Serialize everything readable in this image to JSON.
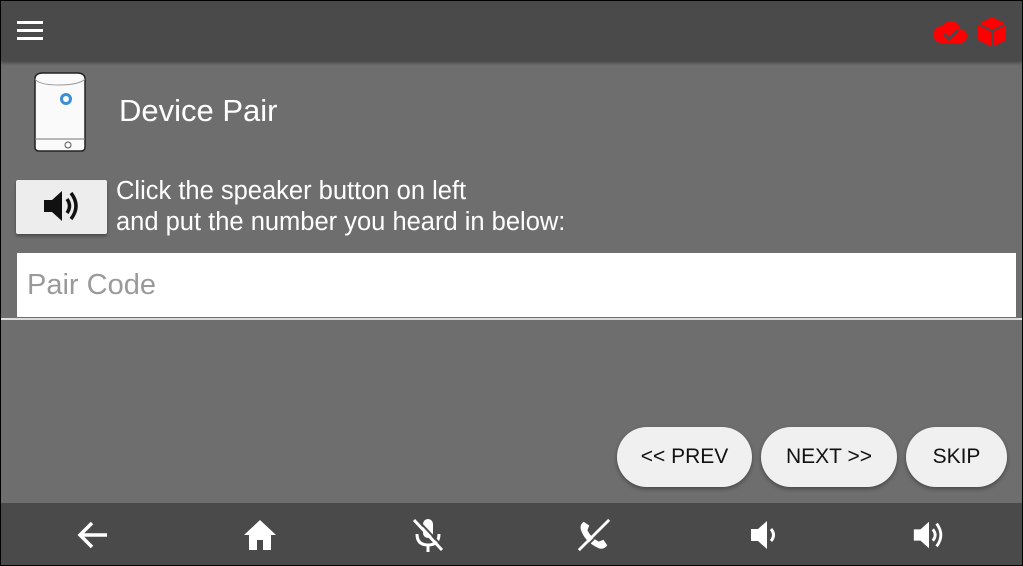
{
  "topbar": {
    "menu_icon": "hamburger-menu-icon",
    "status_icons": [
      "cloud-sync-icon",
      "cube-icon"
    ],
    "status_color": "#ff0000"
  },
  "header": {
    "title": "Device Pair",
    "device_icon": "device-hub-image"
  },
  "instructions": {
    "line1": "Click the speaker button on left",
    "line2": "and put the number you heard in below:"
  },
  "speaker_button": {
    "icon": "speaker-volume-icon"
  },
  "pair_code": {
    "placeholder": "Pair Code",
    "value": ""
  },
  "buttons": {
    "prev": "<< PREV",
    "next": "NEXT >>",
    "skip": "SKIP"
  },
  "bottom_nav": [
    "back-arrow-icon",
    "home-icon",
    "mic-off-icon",
    "call-end-icon",
    "volume-down-icon",
    "volume-up-icon"
  ],
  "colors": {
    "bar": "#4a4a4a",
    "background": "#6e6e6e",
    "button": "#f0f0f0"
  }
}
